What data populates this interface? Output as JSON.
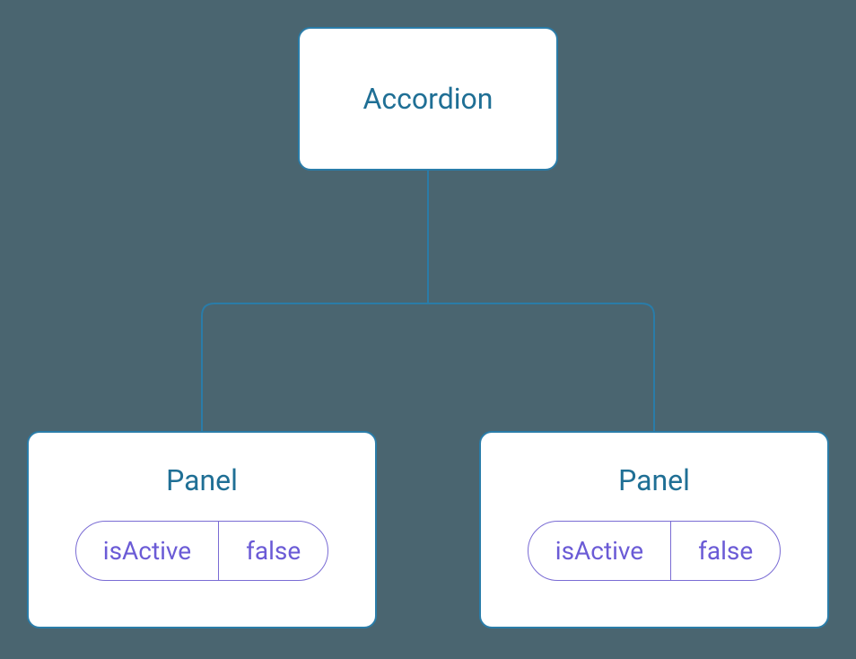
{
  "root": {
    "title": "Accordion"
  },
  "children": [
    {
      "title": "Panel",
      "prop": {
        "key": "isActive",
        "value": "false"
      }
    },
    {
      "title": "Panel",
      "prop": {
        "key": "isActive",
        "value": "false"
      }
    }
  ],
  "colors": {
    "background": "#4a6570",
    "node_border": "#2a7ca8",
    "node_fill": "#ffffff",
    "title_text": "#1f6f95",
    "pill_border": "#7a6cd4",
    "pill_text": "#6b5bd6"
  }
}
